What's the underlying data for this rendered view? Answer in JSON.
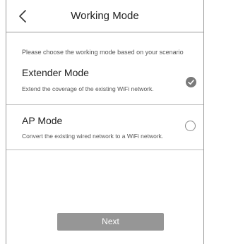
{
  "header": {
    "title": "Working Mode",
    "back_icon": "chevron-left-icon"
  },
  "hint": "Please choose the working mode based on your scenario",
  "modes": [
    {
      "title": "Extender Mode",
      "description": "Extend the coverage of the existing WiFi network.",
      "selected": true
    },
    {
      "title": "AP Mode",
      "description": "Convert the existing wired network to a WiFi network.",
      "selected": false
    }
  ],
  "next_label": "Next",
  "colors": {
    "button": "#969696",
    "radio_checked": "#7a7a7a",
    "border": "#9a9a9a"
  }
}
